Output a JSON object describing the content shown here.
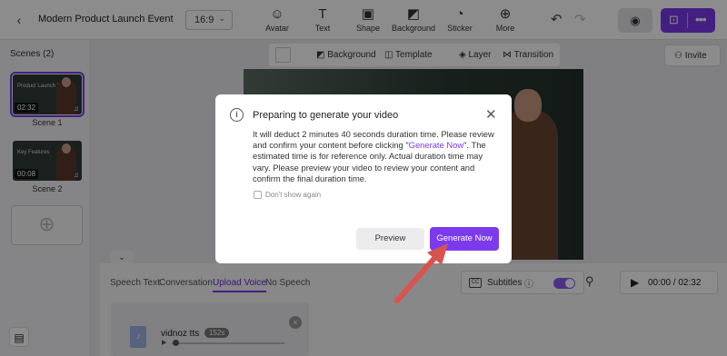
{
  "topbar": {
    "back_icon": "chevron-left-icon",
    "title": "Modern Product Launch Event",
    "aspect_ratio": "16:9",
    "tools": [
      {
        "label": "Avatar",
        "icon": "avatar-icon"
      },
      {
        "label": "Text",
        "icon": "text-icon"
      },
      {
        "label": "Shape",
        "icon": "shape-icon"
      },
      {
        "label": "Background",
        "icon": "background-icon"
      },
      {
        "label": "Sticker",
        "icon": "sticker-icon"
      },
      {
        "label": "More",
        "icon": "more-icon"
      }
    ]
  },
  "sidebar": {
    "heading": "Scenes (2)",
    "scenes": [
      {
        "label": "Scene 1",
        "duration": "02:32",
        "thumb_text": "Product Launch Video"
      },
      {
        "label": "Scene 2",
        "duration": "00:08",
        "thumb_text": "Key Features"
      }
    ]
  },
  "canvas_toolbar": {
    "background": "Background",
    "template": "Template",
    "layer": "Layer",
    "transition": "Transition"
  },
  "invite": "Invite",
  "bottom": {
    "tabs": [
      "Speech Text",
      "Conversation",
      "Upload Voice",
      "No Speech"
    ],
    "active_tab": "Upload Voice",
    "subtitles_label": "Subtitles",
    "subtitles_on": true,
    "time": "00:00 / 02:32",
    "audio": {
      "name": "vidnoz tts",
      "duration_badge": "152s"
    }
  },
  "modal": {
    "title": "Preparing to generate your video",
    "body_pre": "It will deduct 2 minutes 40 seconds duration time. Please review and confirm your content before clicking \"",
    "body_highlight": "Generate Now",
    "body_post": "\". The estimated time is for reference only. Actual duration time may vary. Please preview your video to review your content and confirm the final duration time.",
    "checkbox_label": "Don't show again",
    "preview_button": "Preview",
    "generate_button": "Generate Now"
  },
  "colors": {
    "accent": "#7c3aed",
    "annotation_arrow": "#d9534f"
  }
}
